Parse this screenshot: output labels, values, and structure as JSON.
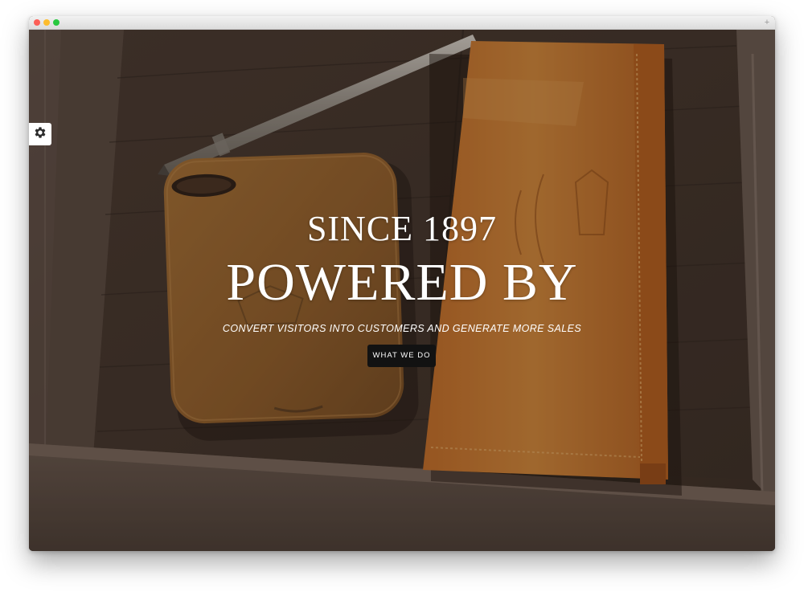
{
  "hero": {
    "overline": "SINCE 1897",
    "headline": "POWERED BY",
    "tagline": "CONVERT VISITORS INTO CUSTOMERS AND GENERATE MORE SALES",
    "cta_label": "WHAT WE DO"
  },
  "browser": {
    "new_tab_glyph": "+"
  },
  "icons": {
    "settings": "gear-icon"
  },
  "colors": {
    "button_bg": "#121212",
    "wood_tray": "#4a3a30",
    "leather_pouch": "#c8792f",
    "phone_case": "#a26a30"
  }
}
